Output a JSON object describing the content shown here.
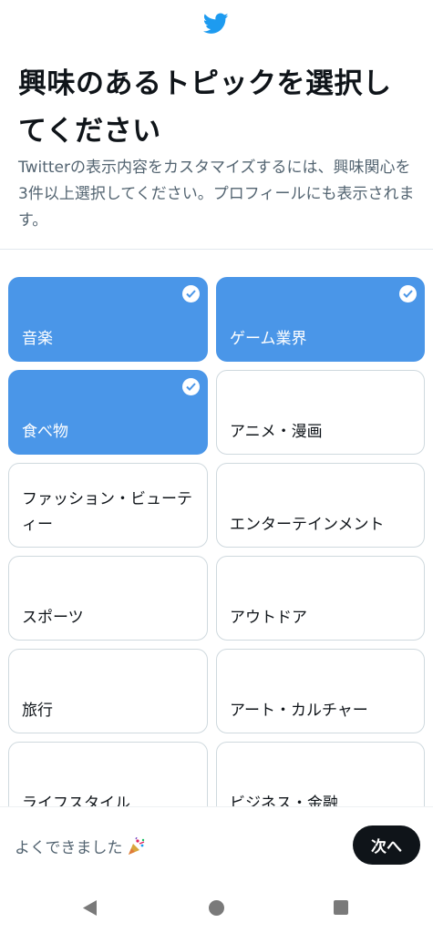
{
  "header": {
    "logo_icon": "twitter-bird-icon",
    "brand_color": "#1d9bf0"
  },
  "page": {
    "title": "興味のあるトピックを選択してください",
    "description": "Twitterの表示内容をカスタマイズするには、興味関心を3件以上選択してください。プロフィールにも表示されます。"
  },
  "topics": [
    {
      "label": "音楽",
      "selected": true
    },
    {
      "label": "ゲーム業界",
      "selected": true
    },
    {
      "label": "食べ物",
      "selected": true
    },
    {
      "label": "アニメ・漫画",
      "selected": false
    },
    {
      "label": "ファッション・ビューティー",
      "selected": false
    },
    {
      "label": "エンターテインメント",
      "selected": false
    },
    {
      "label": "スポーツ",
      "selected": false
    },
    {
      "label": "アウトドア",
      "selected": false
    },
    {
      "label": "旅行",
      "selected": false
    },
    {
      "label": "アート・カルチャー",
      "selected": false
    },
    {
      "label": "ライフスタイル",
      "selected": false
    },
    {
      "label": "ビジネス・金融",
      "selected": false
    }
  ],
  "footer": {
    "progress_text": "よくできました",
    "progress_icon": "party-popper-icon",
    "next_label": "次へ"
  },
  "system_nav": {
    "back_icon": "back-triangle-icon",
    "home_icon": "home-circle-icon",
    "recent_icon": "recent-square-icon"
  },
  "colors": {
    "selected": "#4a96e8",
    "border": "#cfd9de",
    "button": "#0f1419"
  }
}
